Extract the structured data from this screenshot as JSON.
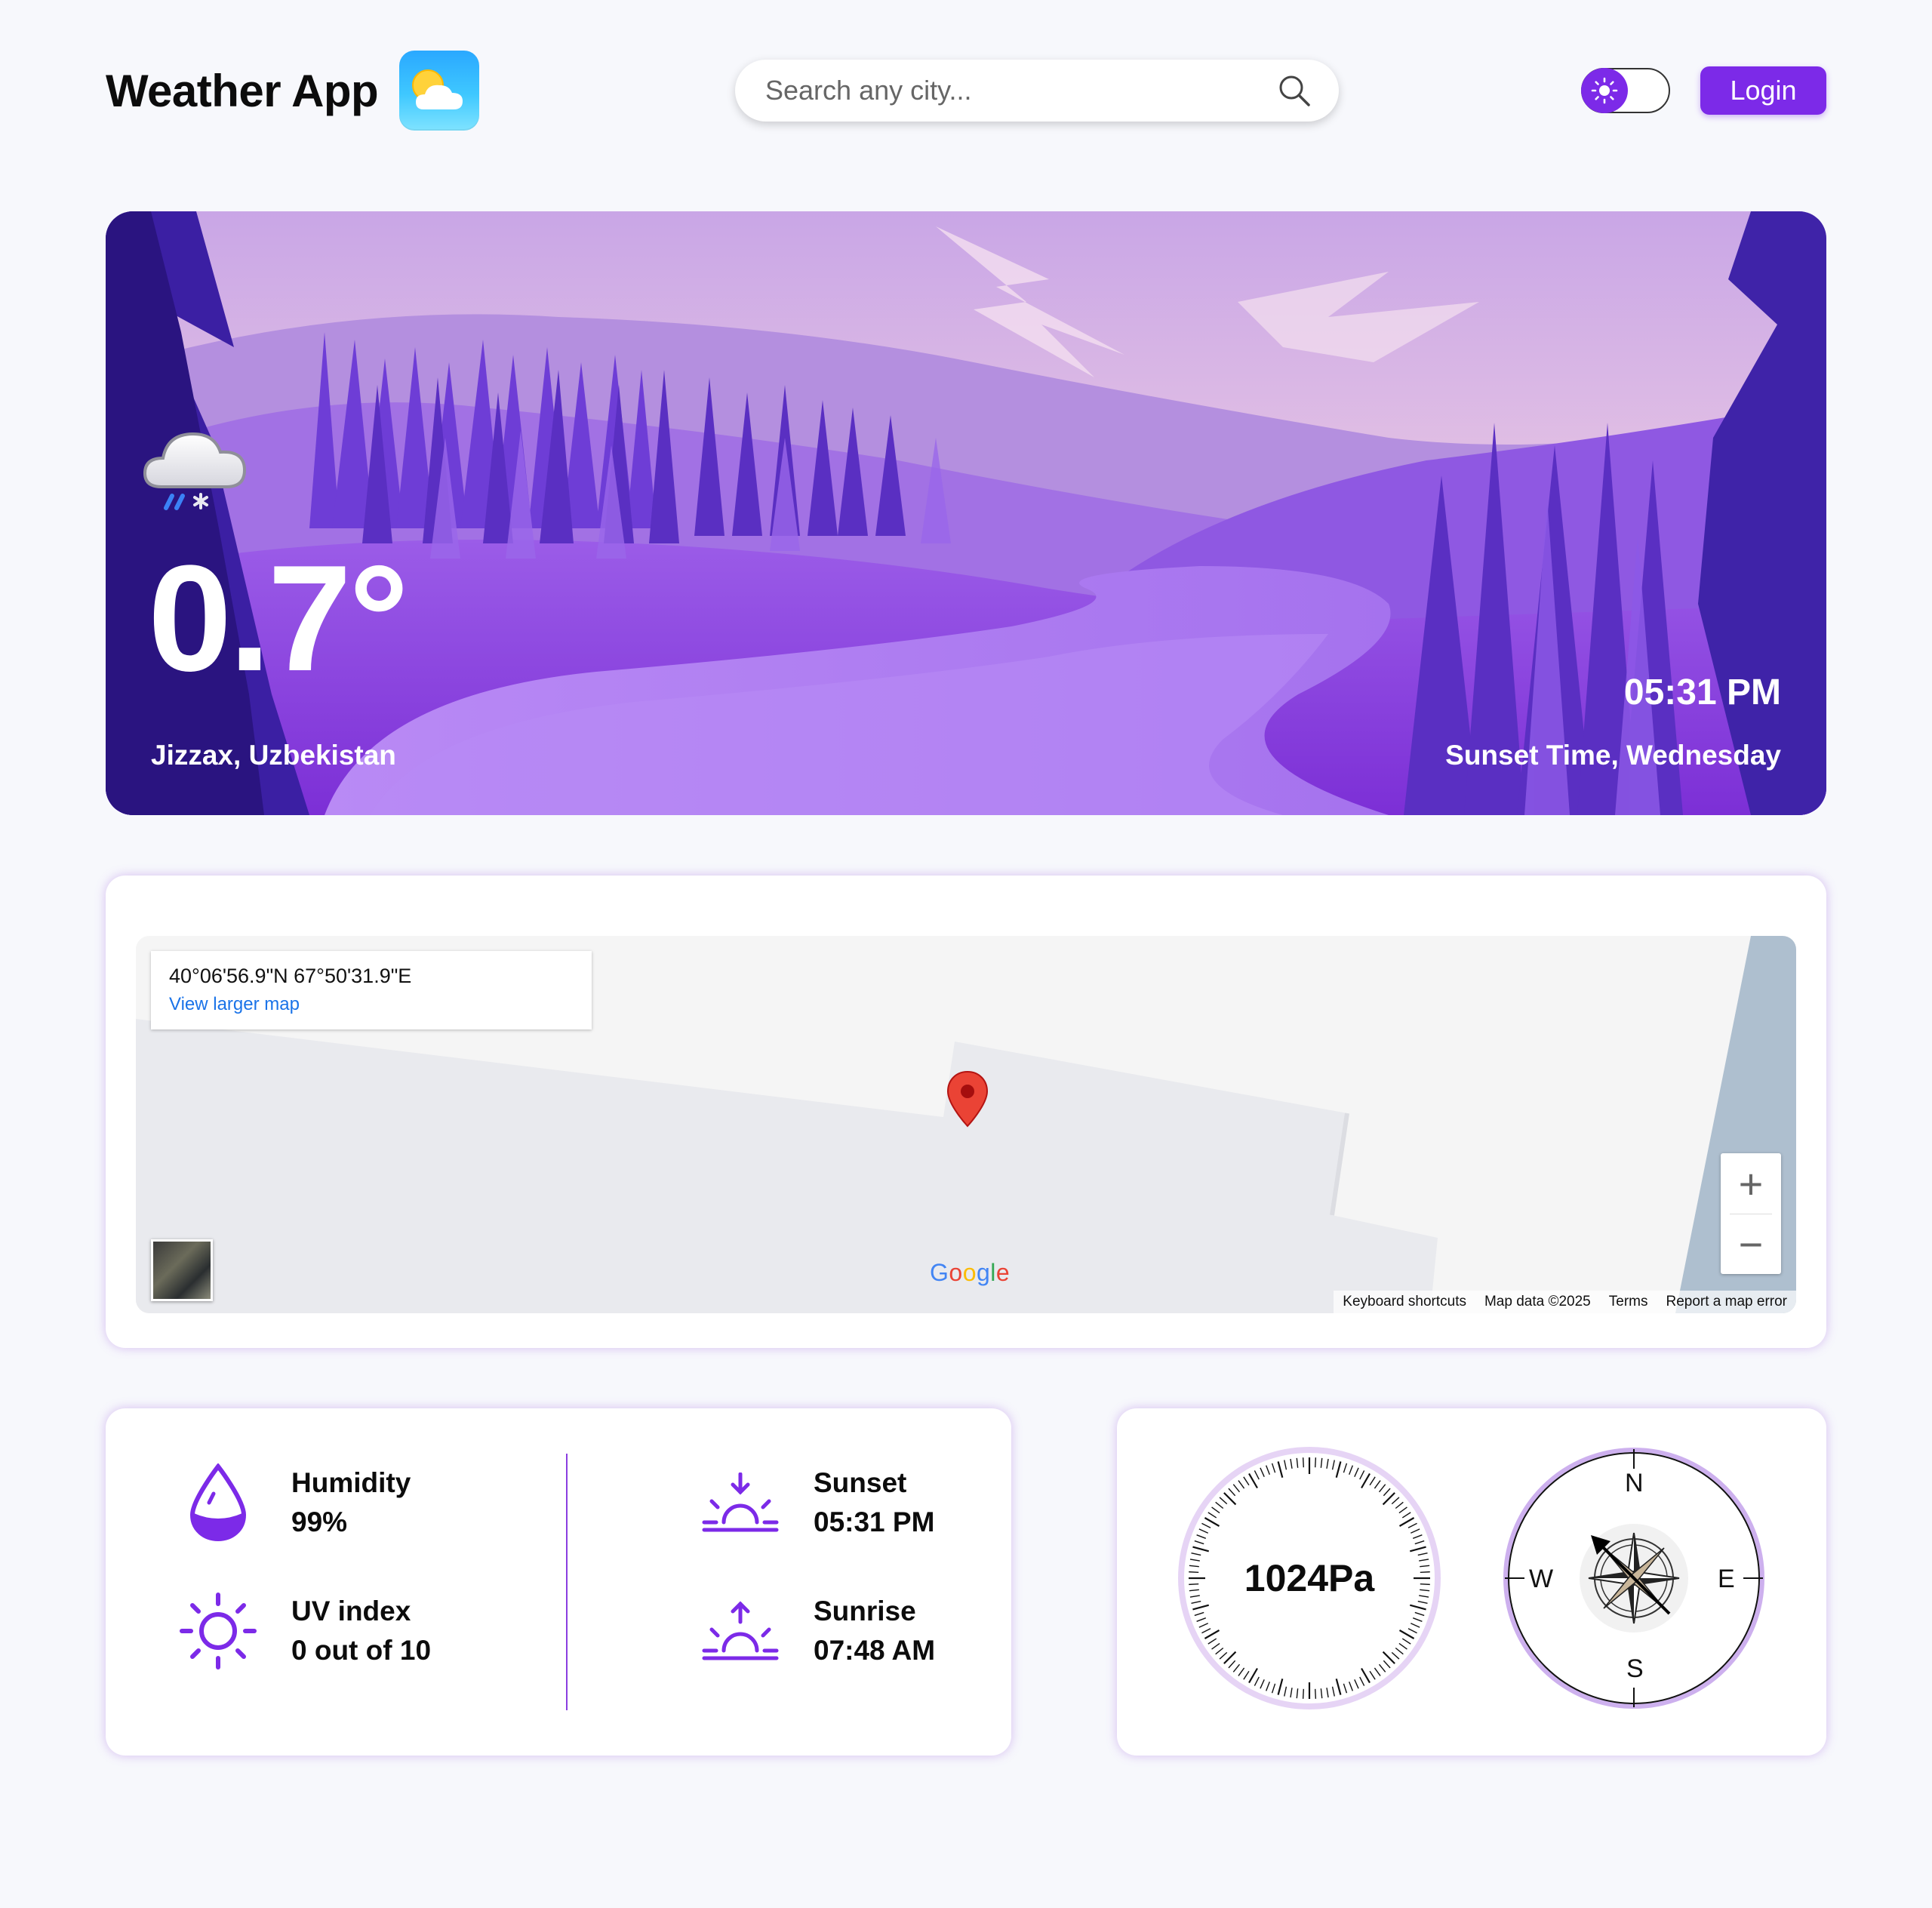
{
  "app": {
    "title": "Weather App",
    "logo_icon": "partly-cloudy-icon"
  },
  "header": {
    "search_placeholder": "Search any city...",
    "search_icon": "search-icon",
    "theme_toggle_icon": "sun-icon",
    "login_label": "Login"
  },
  "hero": {
    "weather_icon": "snow-cloud-icon",
    "temperature": "0.7°",
    "location": "Jizzax, Uzbekistan",
    "time": "05:31 PM",
    "subtitle": "Sunset Time, Wednesday"
  },
  "map": {
    "coordinates": "40°06'56.9\"N 67°50'31.9\"E",
    "view_larger": "View larger map",
    "google_logo": "Google",
    "zoom_in": "+",
    "zoom_out": "−",
    "footer": {
      "keyboard": "Keyboard shortcuts",
      "map_data": "Map data ©2025",
      "terms": "Terms",
      "report": "Report a map error"
    }
  },
  "stats": {
    "humidity": {
      "label": "Humidity",
      "value": "99%",
      "icon": "droplet-icon"
    },
    "uv": {
      "label": "UV index",
      "value": "0 out of 10",
      "icon": "sun-icon"
    },
    "sunset": {
      "label": "Sunset",
      "value": "05:31 PM",
      "icon": "sunset-icon"
    },
    "sunrise": {
      "label": "Sunrise",
      "value": "07:48 AM",
      "icon": "sunrise-icon"
    }
  },
  "gauges": {
    "pressure": "1024Pa",
    "compass": {
      "n": "N",
      "e": "E",
      "s": "S",
      "w": "W",
      "icon": "compass-rose-icon"
    }
  },
  "colors": {
    "accent": "#7c2ae8",
    "background": "#f7f8fc",
    "link": "#1a73e8",
    "map_pin": "#ea4335"
  }
}
